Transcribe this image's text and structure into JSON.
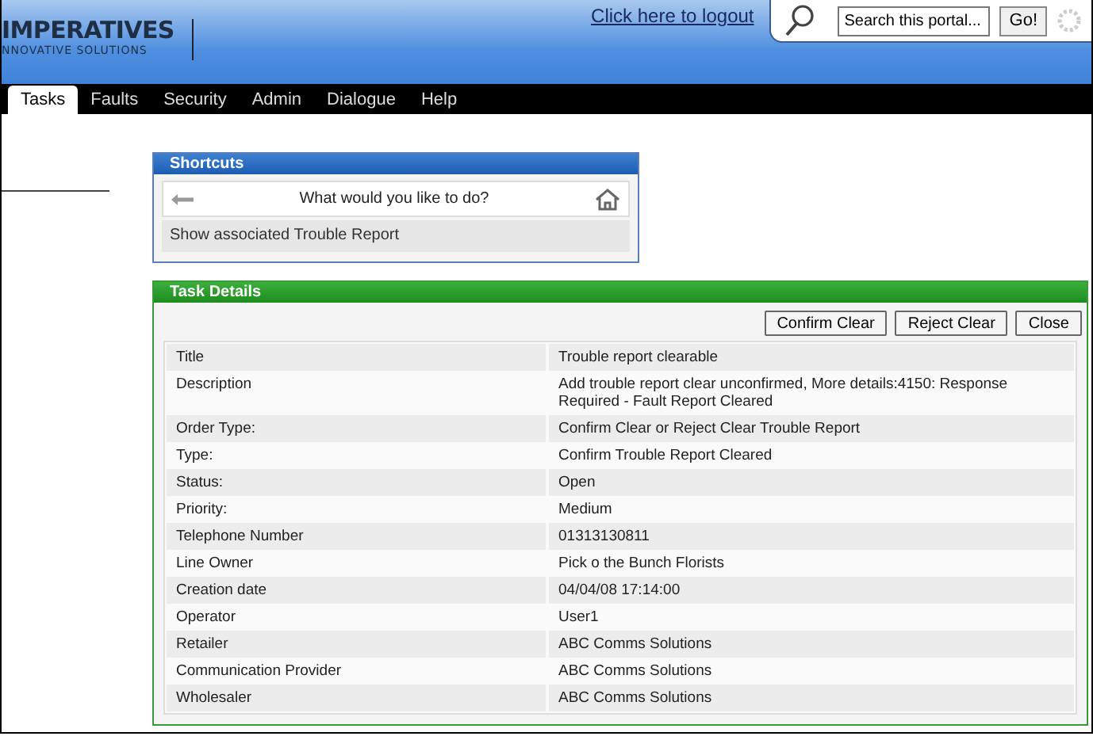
{
  "logo": {
    "name": "IMPERATIVES",
    "tagline": "NNOVATIVE SOLUTIONS"
  },
  "logout_link": "Click here to logout",
  "search": {
    "placeholder": "Search this portal...",
    "button": "Go!"
  },
  "tabs": [
    {
      "label": "Tasks",
      "selected": true
    },
    {
      "label": "Faults",
      "selected": false
    },
    {
      "label": "Security",
      "selected": false
    },
    {
      "label": "Admin",
      "selected": false
    },
    {
      "label": "Dialogue",
      "selected": false
    },
    {
      "label": "Help",
      "selected": false
    }
  ],
  "shortcuts": {
    "title": "Shortcuts",
    "prompt": "What would you like to do?",
    "items": [
      "Show associated Trouble Report"
    ]
  },
  "task_details": {
    "title": "Task Details",
    "buttons": [
      "Confirm Clear",
      "Reject Clear",
      "Close"
    ],
    "rows": [
      {
        "label": "Title",
        "value": "Trouble report clearable"
      },
      {
        "label": "Description",
        "value": "Add trouble report clear unconfirmed, More details:4150: Response Required - Fault Report Cleared"
      },
      {
        "label": "Order Type:",
        "value": "Confirm Clear or Reject Clear Trouble Report"
      },
      {
        "label": "Type:",
        "value": "Confirm Trouble Report Cleared"
      },
      {
        "label": "Status:",
        "value": "Open"
      },
      {
        "label": "Priority:",
        "value": "Medium"
      },
      {
        "label": "Telephone Number",
        "value": "01313130811"
      },
      {
        "label": "Line Owner",
        "value": "Pick o the Bunch Florists"
      },
      {
        "label": "Creation date",
        "value": "04/04/08 17:14:00"
      },
      {
        "label": "Operator",
        "value": "User1"
      },
      {
        "label": "Retailer",
        "value": "ABC Comms Solutions"
      },
      {
        "label": "Communication Provider",
        "value": "ABC Comms Solutions"
      },
      {
        "label": "Wholesaler",
        "value": "ABC Comms Solutions"
      }
    ]
  }
}
